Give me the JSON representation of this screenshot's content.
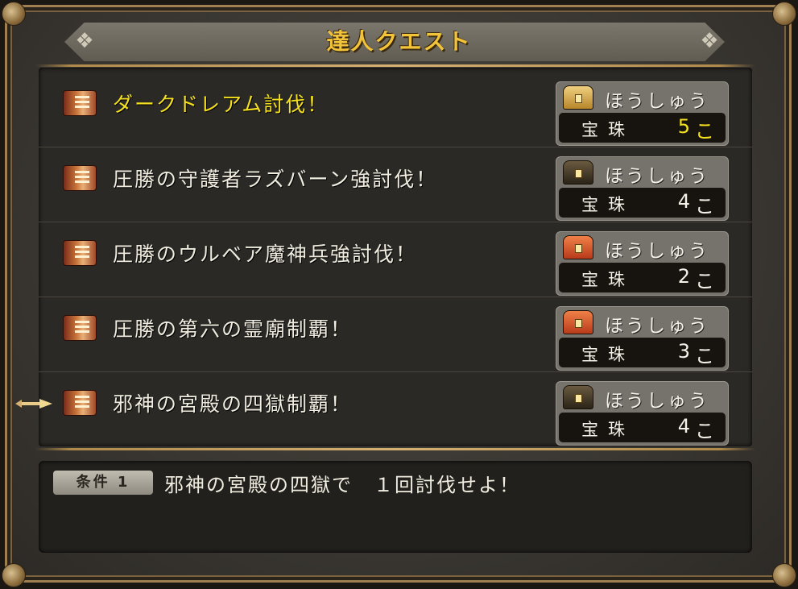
{
  "window": {
    "title": "達人クエスト"
  },
  "quests": [
    {
      "title": "ダークドレアム討伐！",
      "active": true,
      "reward_label": "ほうしゅう",
      "reward_item": "宝珠",
      "reward_qty": "5",
      "reward_unit": "こ",
      "chest": "gold-chest-icon"
    },
    {
      "title": "圧勝の守護者ラズバーン強討伐！",
      "active": false,
      "reward_label": "ほうしゅう",
      "reward_item": "宝珠",
      "reward_qty": "4",
      "reward_unit": "こ",
      "chest": "dark-chest-icon"
    },
    {
      "title": "圧勝のウルベア魔神兵強討伐！",
      "active": false,
      "reward_label": "ほうしゅう",
      "reward_item": "宝珠",
      "reward_qty": "2",
      "reward_unit": "こ",
      "chest": "red-chest-icon"
    },
    {
      "title": "圧勝の第六の霊廟制覇！",
      "active": false,
      "reward_label": "ほうしゅう",
      "reward_item": "宝珠",
      "reward_qty": "3",
      "reward_unit": "こ",
      "chest": "red-chest-icon"
    },
    {
      "title": "邪神の宮殿の四獄制覇！",
      "active": false,
      "reward_label": "ほうしゅう",
      "reward_item": "宝珠",
      "reward_qty": "4",
      "reward_unit": "こ",
      "chest": "dark-chest-icon"
    }
  ],
  "selected_index": 4,
  "condition": {
    "badge": "条件 1",
    "text": "邪神の宮殿の四獄で　１回討伐せよ！"
  },
  "colors": {
    "title_gold": "#f3c43a",
    "active_yellow": "#f4e020",
    "frame_gold": "#a08050"
  }
}
